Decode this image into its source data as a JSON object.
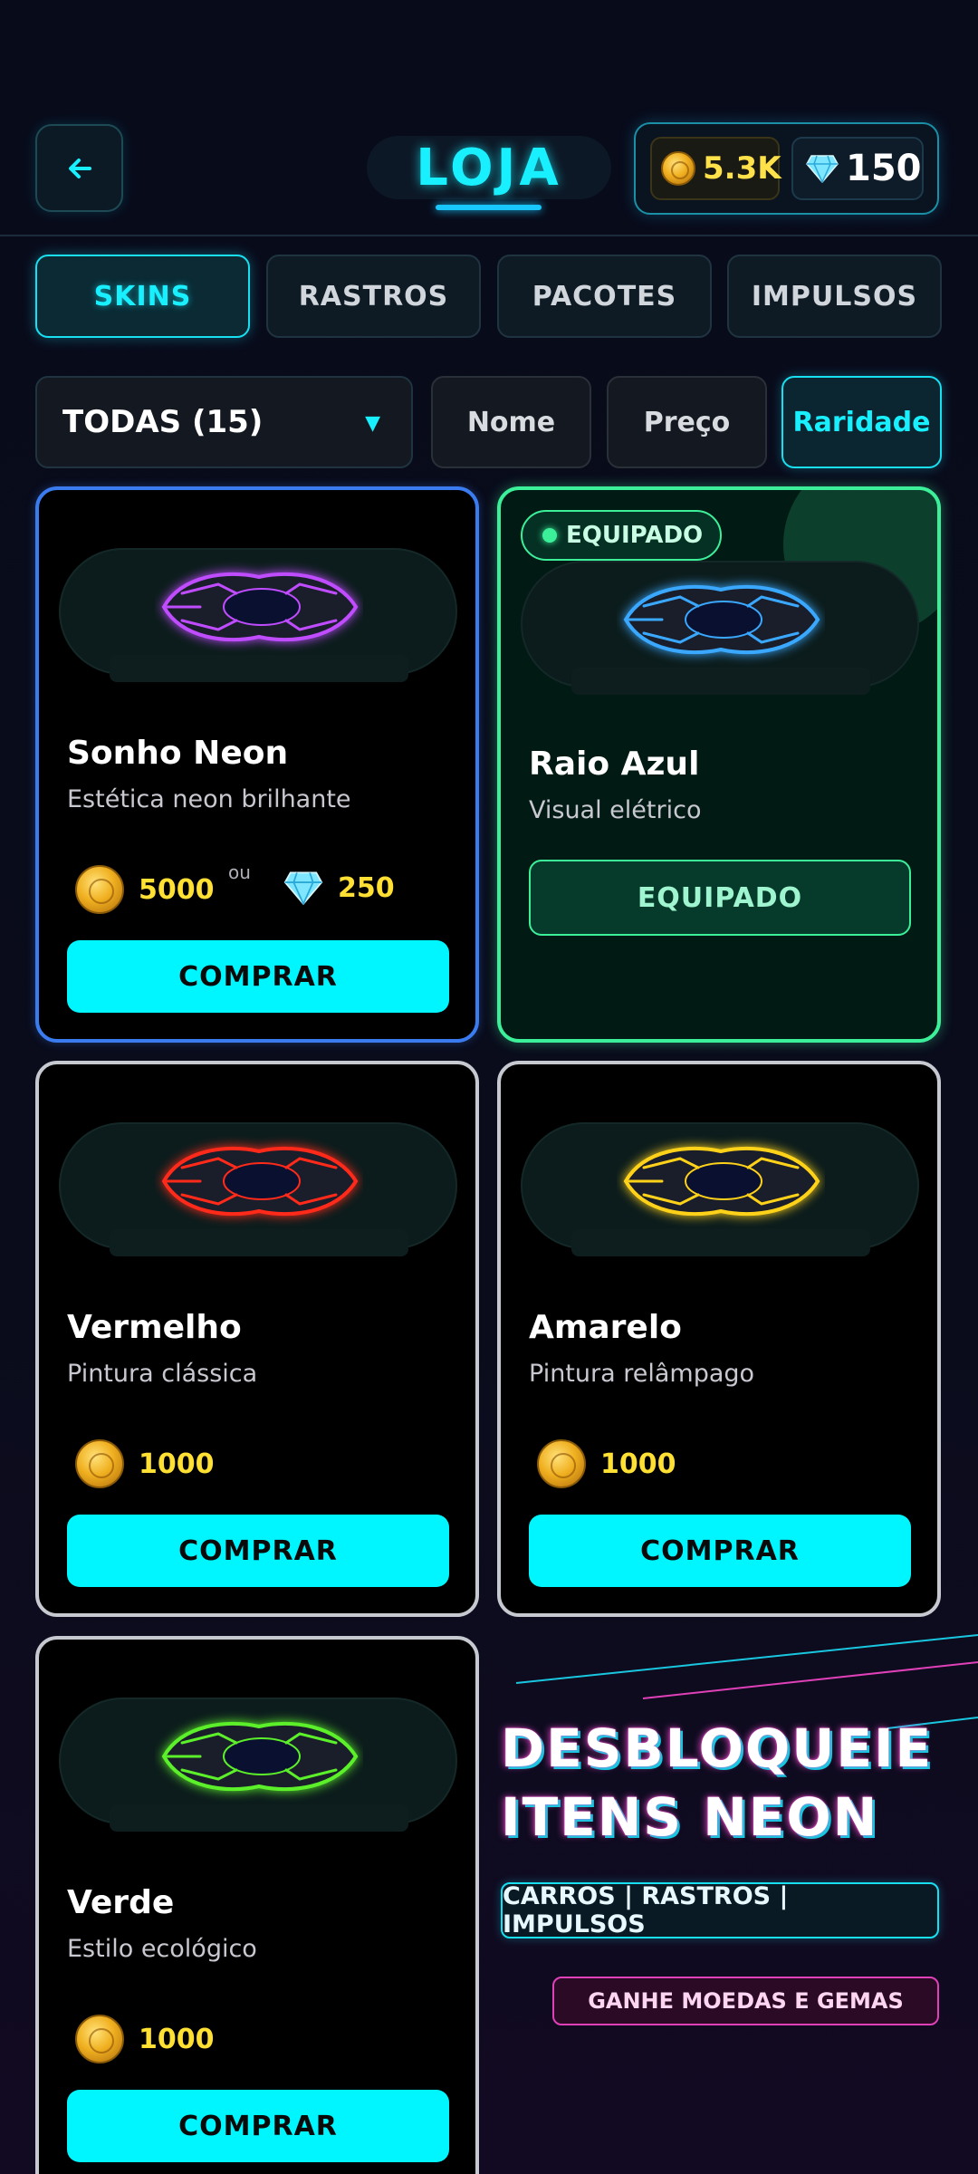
{
  "header": {
    "title": "LOJA",
    "coins": "5.3K",
    "gems": "150"
  },
  "tabs": [
    {
      "label": "SKINS",
      "active": true
    },
    {
      "label": "RASTROS",
      "active": false
    },
    {
      "label": "PACOTES",
      "active": false
    },
    {
      "label": "IMPULSOS",
      "active": false
    }
  ],
  "filter": {
    "selected": "TODAS (15)",
    "sort_options": [
      "Nome",
      "Preço",
      "Raridade"
    ],
    "sort_active": "Raridade"
  },
  "items": [
    {
      "name": "Sonho Neon",
      "desc": "Estética neon brilhante",
      "price_coins": "5000",
      "or_label": "ou",
      "price_gems": "250",
      "button": "COMPRAR",
      "color": "#c04cff"
    },
    {
      "name": "Raio Azul",
      "desc": "Visual elétrico",
      "badge": "EQUIPADO",
      "button": "EQUIPADO",
      "color": "#3aa8ff"
    },
    {
      "name": "Vermelho",
      "desc": "Pintura clássica",
      "price_coins": "1000",
      "button": "COMPRAR",
      "color": "#ff2a1a"
    },
    {
      "name": "Amarelo",
      "desc": "Pintura relâmpago",
      "price_coins": "1000",
      "button": "COMPRAR",
      "color": "#ffd21a"
    },
    {
      "name": "Verde",
      "desc": "Estilo ecológico",
      "price_coins": "1000",
      "button": "COMPRAR",
      "color": "#5cf02a"
    }
  ],
  "promo": {
    "line1": "DESBLOQUEIE",
    "line2": "ITENS NEON",
    "tag": "CARROS | RASTROS | IMPULSOS",
    "pill": "GANHE MOEDAS E GEMAS"
  },
  "colors": {
    "accent": "#19f0ff",
    "coin_text": "#ffe033",
    "equipped": "#3cf09a",
    "rare_border": "#3a7cf0"
  }
}
